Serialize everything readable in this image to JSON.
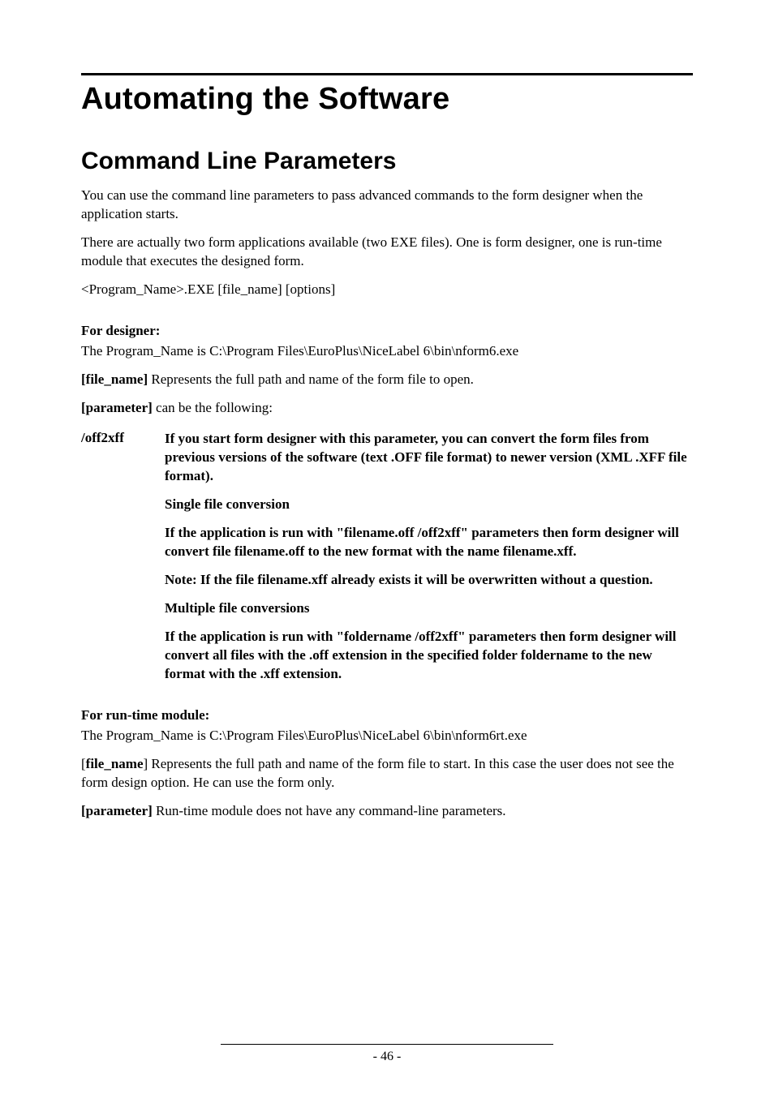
{
  "title": "Automating the Software",
  "section_title": "Command Line Parameters",
  "intro_p1": "You can use the command line parameters to pass advanced commands to the form designer when the application starts.",
  "intro_p2": "There are actually two form applications available (two EXE files). One is form designer, one is run-time module that executes the designed form.",
  "usage_line": "<Program_Name>.EXE [file_name] [options]",
  "designer": {
    "heading": "For designer:",
    "program_name_line": "The Program_Name is C:\\Program Files\\EuroPlus\\NiceLabel 6\\bin\\nform6.exe",
    "filename_label": "[file_name]",
    "filename_desc": " Represents the full path and name of the form file to open.",
    "parameter_label": "[parameter]",
    "parameter_desc": " can be the following:"
  },
  "param": {
    "key": "/off2xff",
    "p1": "If you start form designer with this parameter, you can convert the form files from previous versions of the software (text .OFF file format) to newer version (XML .XFF file format).",
    "p2": "Single file conversion",
    "p3": "If the application is run with \"filename.off /off2xff\" parameters then form designer will convert file filename.off to the new format with the name filename.xff.",
    "p4": "Note: If the file filename.xff already exists it will be overwritten without a question.",
    "p5": "Multiple file conversions",
    "p6": "If the application is run with \"foldername /off2xff\" parameters then form designer will convert all files with the .off extension in the specified folder foldername to the new format with the .xff extension."
  },
  "runtime": {
    "heading": "For run-time module:",
    "program_name_line": "The Program_Name is C:\\Program Files\\EuroPlus\\NiceLabel 6\\bin\\nform6rt.exe",
    "filename_prefix": "[",
    "filename_label": "file_name",
    "filename_suffix": "]",
    "filename_desc": " Represents the full path and name of the form file to start. In this case the user does not see the form design option. He can use the form only.",
    "parameter_label": "[parameter]",
    "parameter_desc": " Run-time module does not have any command-line parameters."
  },
  "page_number": "- 46 -"
}
